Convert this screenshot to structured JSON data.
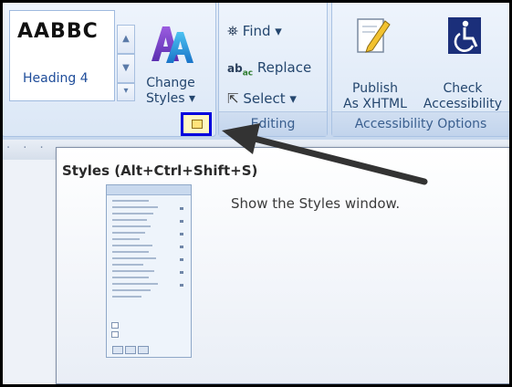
{
  "ribbon": {
    "styles_gallery": {
      "sample_text": "AABBC",
      "heading_text": "Heading 4"
    },
    "change_styles": {
      "line1": "Change",
      "line2": "Styles ▾"
    },
    "editing": {
      "group_label": "Editing",
      "find_label": "Find ▾",
      "replace_label": "Replace",
      "select_label": "Select ▾"
    },
    "accessibility": {
      "group_label": "Accessibility Options",
      "publish_line1": "Publish",
      "publish_line2": "As XHTML",
      "check_line1": "Check",
      "check_line2": "Accessibility"
    }
  },
  "ruler": {
    "dots": "· · ·"
  },
  "tooltip": {
    "title": "Styles (Alt+Ctrl+Shift+S)",
    "description": "Show the Styles window."
  },
  "colors": {
    "highlight_box": "#0000dd",
    "arrow": "#333333"
  }
}
